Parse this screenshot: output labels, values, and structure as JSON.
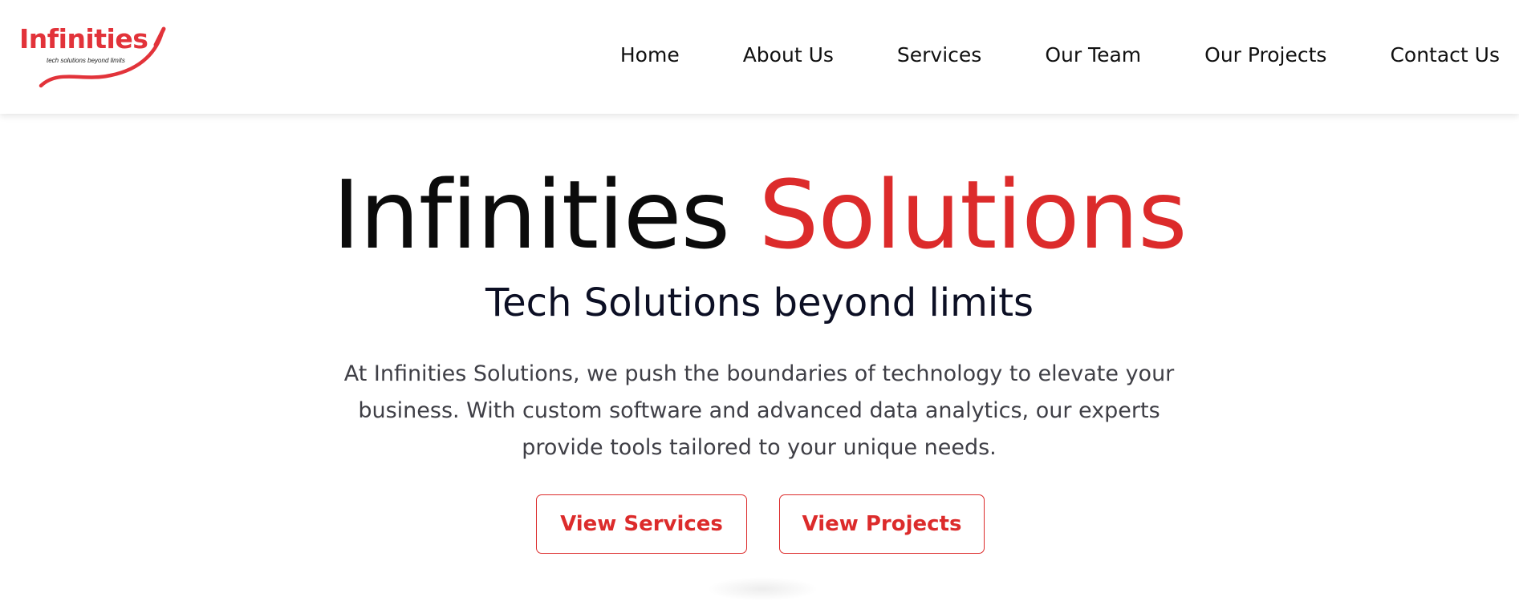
{
  "brand": {
    "logo_text": "Infinities",
    "logo_tagline": "tech solutions beyond limits",
    "accent_color": "#dc2b2b"
  },
  "nav": {
    "items": [
      {
        "label": "Home"
      },
      {
        "label": "About Us"
      },
      {
        "label": "Services"
      },
      {
        "label": "Our Team"
      },
      {
        "label": "Our Projects"
      },
      {
        "label": "Contact Us"
      }
    ]
  },
  "hero": {
    "title_main": "Infinities",
    "title_accent": "Solutions",
    "subtitle": "Tech Solutions beyond limits",
    "description": "At Infinities Solutions, we push the boundaries of technology to elevate your business. With custom software and advanced data analytics, our experts provide tools tailored to your unique needs.",
    "primary_button": "View Services",
    "secondary_button": "View Projects"
  }
}
